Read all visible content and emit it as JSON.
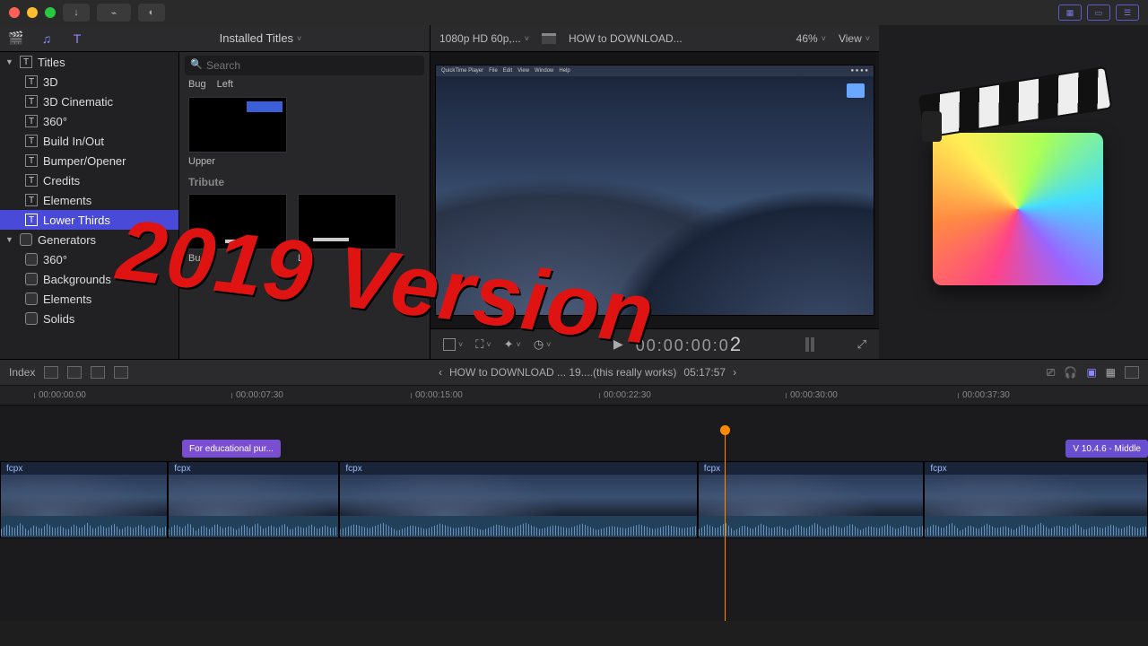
{
  "titlebar": {},
  "browser": {
    "toolbar_title": "Installed Titles",
    "search_placeholder": "Search",
    "titles_section": "Titles",
    "generators_section": "Generators",
    "title_items": [
      "3D",
      "3D Cinematic",
      "360°",
      "Build In/Out",
      "Bumper/Opener",
      "Credits",
      "Elements",
      "Lower Thirds"
    ],
    "title_selected": "Lower Thirds",
    "generator_items": [
      "360°",
      "Backgrounds",
      "Elements",
      "Solids"
    ],
    "groups": [
      {
        "name": "",
        "thumbs": [
          "Bug",
          "Left"
        ]
      },
      {
        "name": "",
        "thumbs": [
          "Upper"
        ]
      },
      {
        "name": "Tribute",
        "thumbs": [
          "Bu",
          "Left"
        ]
      }
    ]
  },
  "viewer": {
    "format": "1080p HD 60p,...",
    "project_name": "HOW to DOWNLOAD...",
    "zoom": "46%",
    "view_label": "View",
    "timecode_prefix": "00:00:00:0",
    "timecode_last": "2",
    "crop_label": "",
    "preview_menu": [
      "QuickTime Player",
      "File",
      "Edit",
      "View",
      "Window",
      "Help"
    ]
  },
  "timeline_bar": {
    "index_label": "Index",
    "clip_title": "HOW to DOWNLOAD ... 19....(this really works)",
    "duration": "05:17:57"
  },
  "ruler": [
    "00:00:00:00",
    "00:00:07:30",
    "00:00:15:00",
    "00:00:22:30",
    "00:00:30:00",
    "00:00:37:30"
  ],
  "timeline": {
    "title_clip_left": "For educational pur...",
    "title_clip_right": "V 10.4.6 - Middle",
    "clip_label": "fcpx",
    "clip_widths": [
      195,
      199,
      416,
      263,
      260
    ]
  },
  "overlay": "2019 Version"
}
